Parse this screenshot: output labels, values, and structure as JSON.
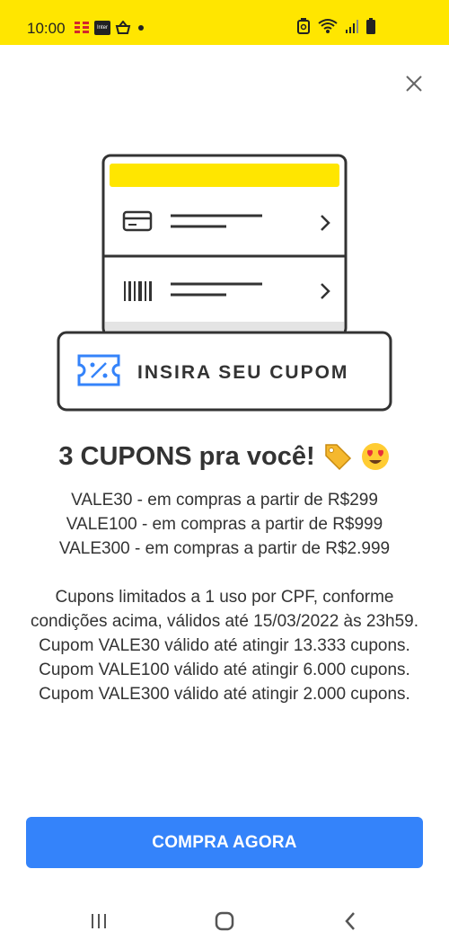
{
  "status_bar": {
    "time": "10:00",
    "icons": [
      "brand-app-icon",
      "inter-app-icon",
      "basket-app-icon",
      "notification-dot-icon",
      "recycle-icon",
      "wifi-icon",
      "signal-icon",
      "battery-icon"
    ],
    "inter_label": "Inter"
  },
  "illustration": {
    "label": "INSIRA SEU CUPOM"
  },
  "heading": {
    "text": "3 CUPONS pra você!"
  },
  "coupons": [
    "VALE30 - em compras a partir de R$299",
    "VALE100 - em compras a partir de R$999",
    "VALE300 - em compras a partir de R$2.999"
  ],
  "terms": {
    "line1": "Cupons limitados a 1 uso por CPF, conforme condições acima, válidos até 15/03/2022 às 23h59.",
    "line2": "Cupom VALE30 válido até atingir 13.333 cupons. Cupom VALE100 válido até atingir 6.000 cupons. Cupom VALE300 válido até atingir 2.000 cupons."
  },
  "cta": {
    "label": "COMPRA AGORA"
  },
  "colors": {
    "brand_yellow": "#FFE600",
    "cta_blue": "#3483FA",
    "ticket_blue": "#3483FA"
  }
}
